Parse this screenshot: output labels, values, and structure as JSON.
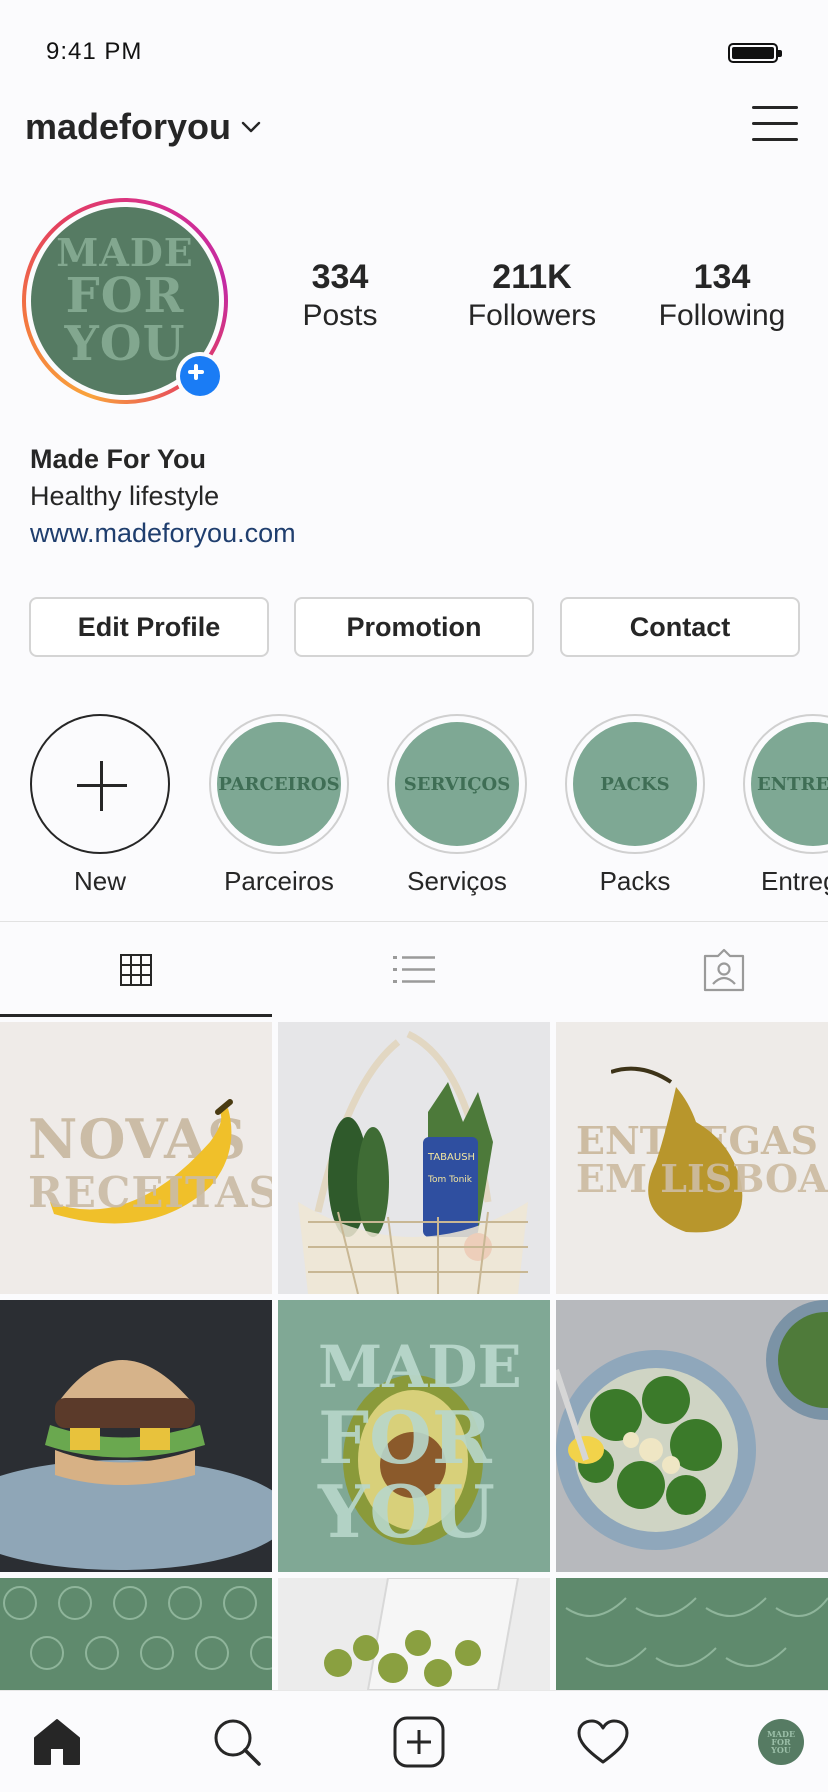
{
  "status": {
    "time": "9:41 PM"
  },
  "header": {
    "username": "madeforyou"
  },
  "avatar": {
    "lines": [
      "MADE",
      "FOR",
      "YOU"
    ],
    "bg": "#567b63",
    "fg": "#82a78f"
  },
  "stats": [
    {
      "value": "334",
      "label": "Posts"
    },
    {
      "value": "211K",
      "label": "Followers"
    },
    {
      "value": "134",
      "label": "Following"
    }
  ],
  "bio": {
    "name": "Made For You",
    "description": "Healthy lifestyle",
    "link": "www.madeforyou.com"
  },
  "buttons": {
    "edit": "Edit Profile",
    "promotion": "Promotion",
    "contact": "Contact"
  },
  "highlights": [
    {
      "label": "New",
      "cover": ""
    },
    {
      "label": "Parceiros",
      "cover": "PARCEIROS"
    },
    {
      "label": "Serviços",
      "cover": "SERVIÇOS"
    },
    {
      "label": "Packs",
      "cover": "PACKS"
    },
    {
      "label": "Entregas",
      "cover": "ENTREGAS"
    }
  ],
  "tabs": [
    "grid-icon",
    "list-icon",
    "tagged-icon"
  ],
  "posts": {
    "novas": [
      "NOVAS",
      "RECEITAS"
    ],
    "entregas": [
      "ENTREGAS",
      "EM LISBOA"
    ],
    "made": [
      "MADE",
      "FOR",
      "YOU"
    ],
    "jar_label": [
      "TABAUSH",
      "Tom Tonik"
    ]
  },
  "nav": [
    "home-icon",
    "search-icon",
    "new-post-icon",
    "activity-icon",
    "profile-avatar"
  ],
  "colors": {
    "accent_blue": "#1a7cf5",
    "link": "#1f3e6e",
    "brand_green": "#567b63",
    "highlight_green": "#7ea894"
  }
}
